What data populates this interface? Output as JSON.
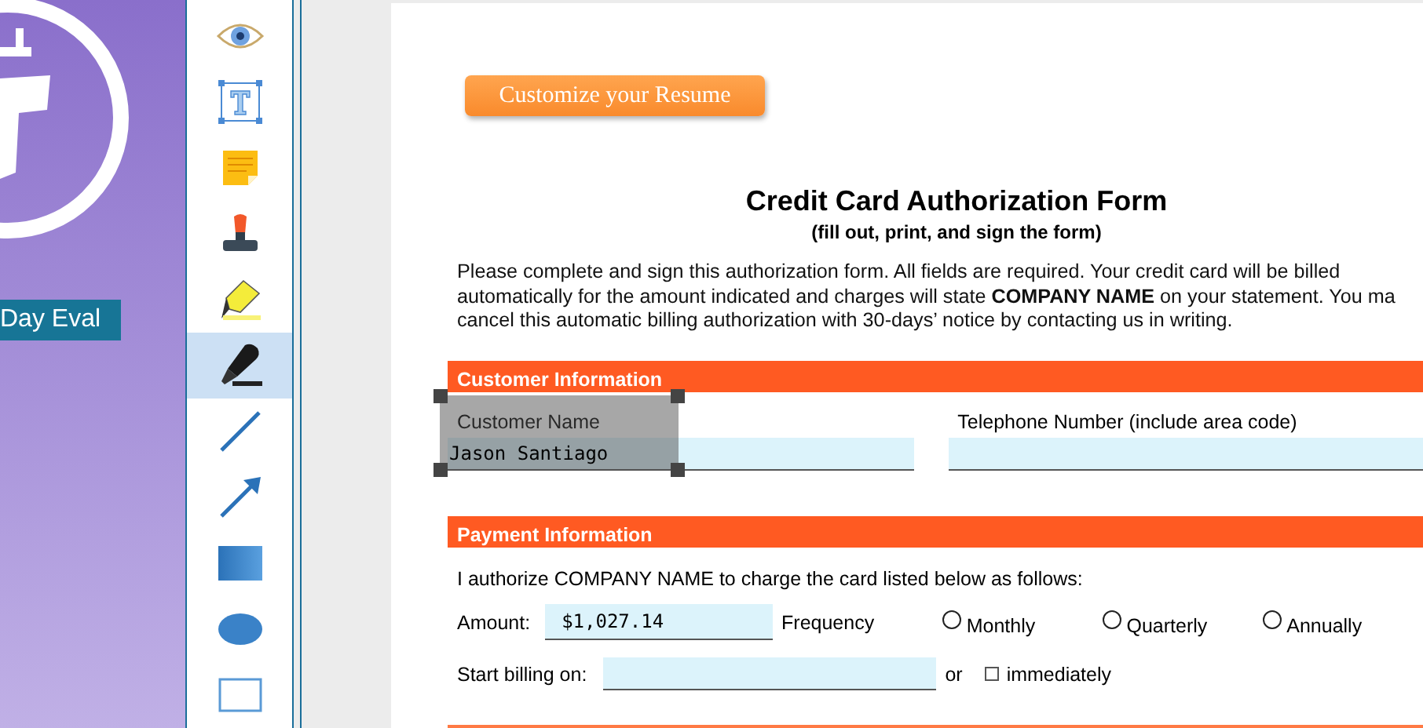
{
  "left_panel": {
    "badge": "Day Eval"
  },
  "toolbar": {
    "tools": [
      {
        "kind": "eye",
        "selected": false
      },
      {
        "kind": "text",
        "selected": false
      },
      {
        "kind": "note",
        "selected": false
      },
      {
        "kind": "stamp",
        "selected": false
      },
      {
        "kind": "highlighter",
        "selected": false
      },
      {
        "kind": "marker",
        "selected": true
      },
      {
        "kind": "line",
        "selected": false
      },
      {
        "kind": "arrow",
        "selected": false
      },
      {
        "kind": "rectangle",
        "selected": false
      },
      {
        "kind": "ellipse",
        "selected": false
      },
      {
        "kind": "frame",
        "selected": false
      }
    ]
  },
  "document": {
    "button": "Customize your Resume",
    "title": "Credit Card Authorization Form",
    "subtitle": "(fill out, print, and sign the form)",
    "intro_lines": [
      "Please complete and sign this authorization form. All fields are required. Your credit card will be billed",
      "automatically for the amount indicated and charges will state **COMPANY NAME** on your statement. You ma",
      "cancel this automatic billing authorization with 30-days’ notice by contacting us in writing."
    ],
    "customer_section": {
      "heading": "Customer Information",
      "name_label": "Customer Name",
      "name_value": "Jason Santiago",
      "phone_label": "Telephone Number (include area code)"
    },
    "payment_section": {
      "heading": "Payment Information",
      "sentence": "I authorize COMPANY NAME to charge the card listed below as follows:",
      "amount_label": "Amount:",
      "amount_value": "$1,027.14",
      "frequency_label": "Frequency",
      "frequencies": [
        {
          "label": "Monthly",
          "selected": false
        },
        {
          "label": "Quarterly",
          "selected": false
        },
        {
          "label": "Annually",
          "selected": false
        }
      ],
      "start_label": "Start billing on:",
      "or_label": "or",
      "immediately": {
        "label": "immediately",
        "checked": false
      }
    }
  }
}
